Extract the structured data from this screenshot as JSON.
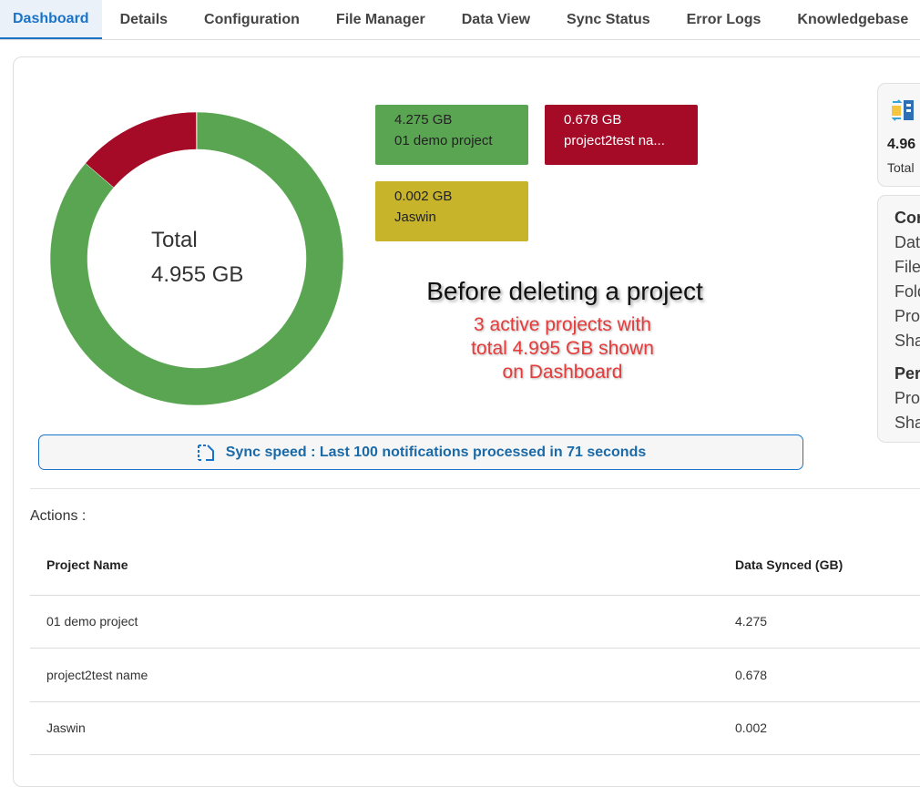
{
  "tabs": [
    {
      "label": "Dashboard",
      "active": true
    },
    {
      "label": "Details"
    },
    {
      "label": "Configuration"
    },
    {
      "label": "File Manager"
    },
    {
      "label": "Data View"
    },
    {
      "label": "Sync Status"
    },
    {
      "label": "Error Logs"
    },
    {
      "label": "Knowledgebase"
    }
  ],
  "donut": {
    "total_label": "Total",
    "total_value": "4.955 GB"
  },
  "chart_data": {
    "type": "pie",
    "categories": [
      "01 demo project",
      "project2test name",
      "Jaswin"
    ],
    "values": [
      4.275,
      0.678,
      0.002
    ],
    "colors": [
      "#5aa552",
      "#a50a27",
      "#c8b42a"
    ]
  },
  "legend": [
    {
      "value": "4.275 GB",
      "name": "01 demo project",
      "color": "#5aa552",
      "text_color": "#222222"
    },
    {
      "value": "0.678 GB",
      "name": "project2test na...",
      "color": "#a50a27",
      "text_color": "#ffffff"
    },
    {
      "value": "0.002 GB",
      "name": "Jaswin",
      "color": "#c8b42a",
      "text_color": "#222222"
    }
  ],
  "annotation": {
    "title": "Before deleting a project",
    "subtitle_lines": [
      "3 active projects with",
      "total 4.995 GB shown",
      "on Dashboard"
    ]
  },
  "sync_speed": {
    "text": "Sync speed : Last 100 notifications processed in 71 seconds"
  },
  "side": {
    "total_value": "4.96",
    "total_label": "Total",
    "section1_head": "Cor",
    "section1_items": [
      "Dat",
      "File",
      "Fold",
      "Pro",
      "Sha"
    ],
    "section2_head": "Per",
    "section2_items": [
      "Pro",
      "Sha"
    ]
  },
  "actions": {
    "label": "Actions :",
    "columns": [
      "Project Name",
      "Data Synced (GB)"
    ],
    "rows": [
      [
        "01 demo project",
        "4.275"
      ],
      [
        "project2test name",
        "0.678"
      ],
      [
        "Jaswin",
        "0.002"
      ]
    ]
  }
}
